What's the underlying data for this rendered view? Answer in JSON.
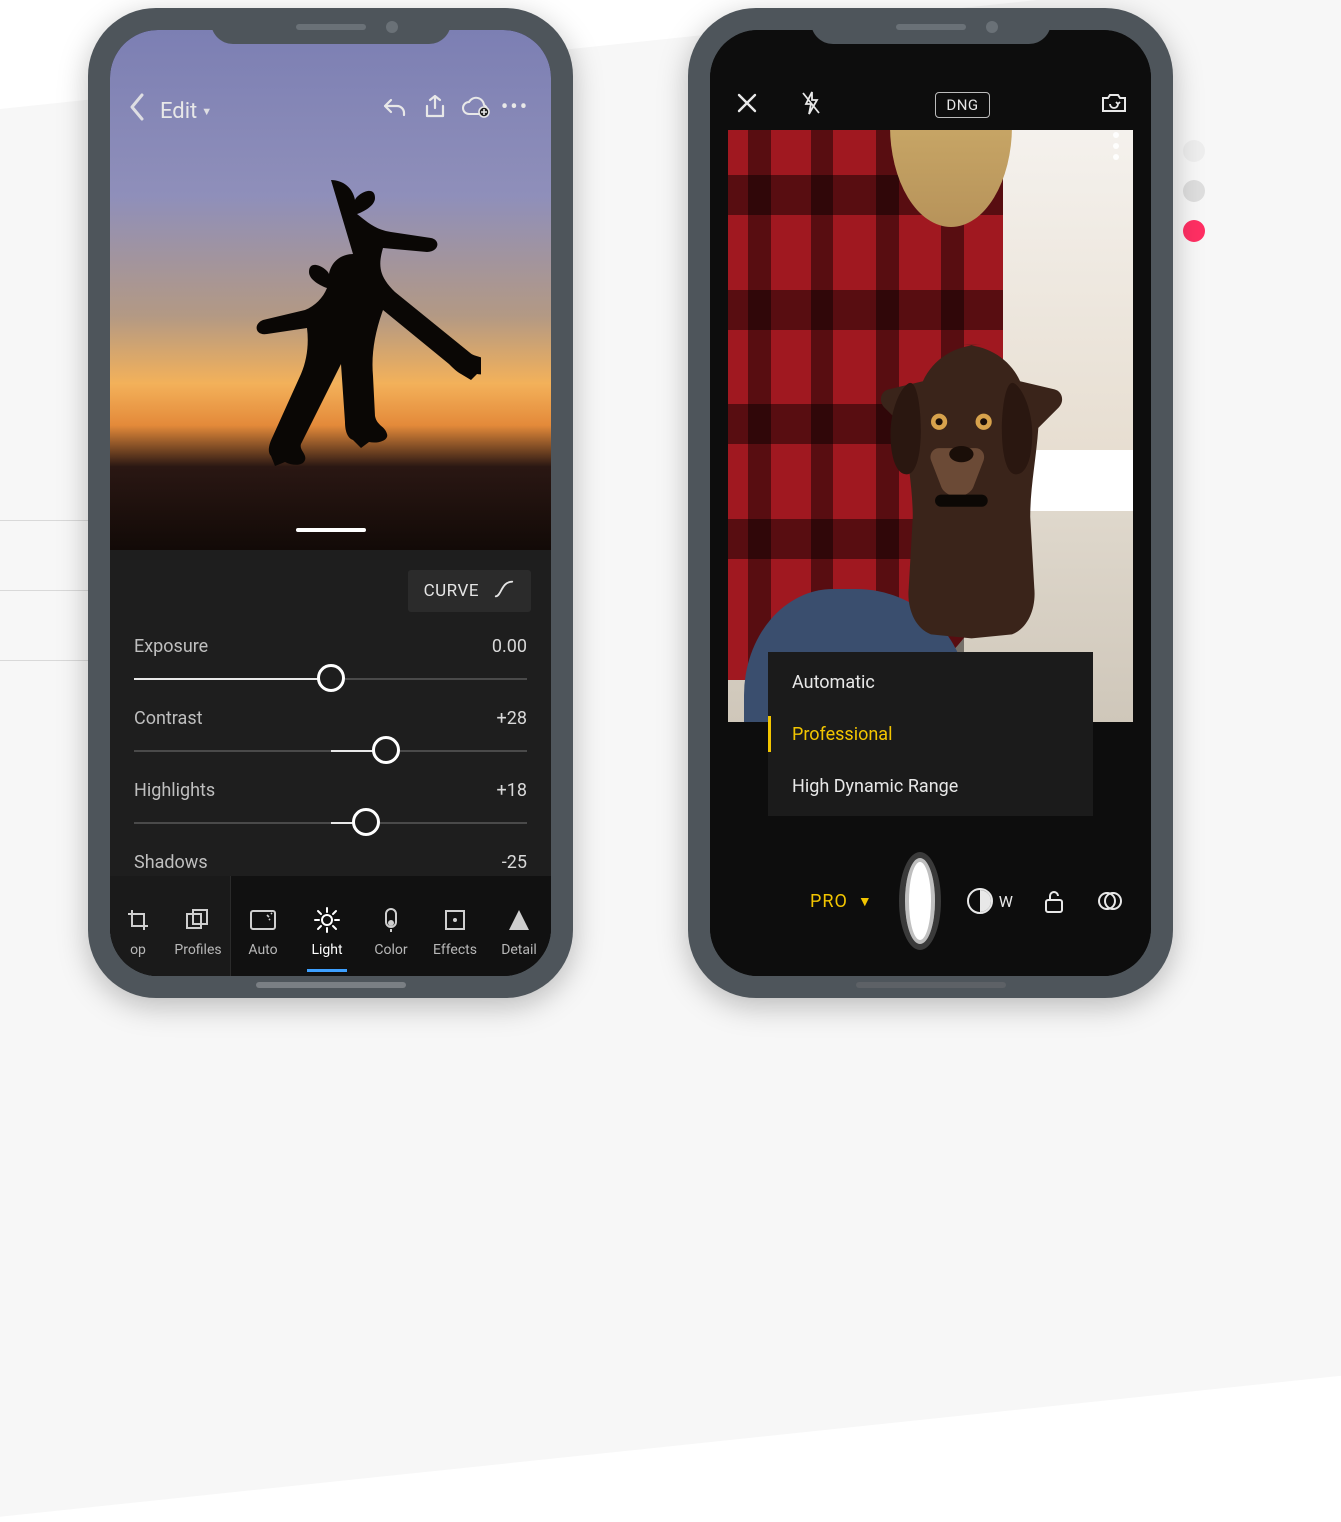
{
  "colors": {
    "accent_blue": "#3ea0ff",
    "accent_yellow": "#f2c500",
    "accent_pink": "#ff2f63",
    "phone_frame": "#4e555b"
  },
  "side_indicator": {
    "dots": [
      "#eeeeee",
      "#dedede",
      "#ff2f63"
    ]
  },
  "left_phone": {
    "header": {
      "back_icon": "chevron-left",
      "title": "Edit",
      "dropdown_icon": "triangle-down",
      "actions": [
        {
          "name": "undo-icon"
        },
        {
          "name": "share-icon"
        },
        {
          "name": "cloud-add-icon"
        },
        {
          "name": "more-icon"
        }
      ]
    },
    "panel": {
      "curve_label": "CURVE",
      "sliders": [
        {
          "key": "exposure",
          "label": "Exposure",
          "value": "0.00",
          "pos": 50
        },
        {
          "key": "contrast",
          "label": "Contrast",
          "value": "+28",
          "pos": 64
        },
        {
          "key": "highlights",
          "label": "Highlights",
          "value": "+18",
          "pos": 59
        },
        {
          "key": "shadows",
          "label": "Shadows",
          "value": "-25",
          "pos": 37
        }
      ]
    },
    "bottom_bar": {
      "items": [
        {
          "key": "crop",
          "label": "op",
          "icon": "crop-icon"
        },
        {
          "key": "profiles",
          "label": "Profiles",
          "icon": "profiles-icon"
        },
        {
          "key": "auto",
          "label": "Auto",
          "icon": "auto-icon"
        },
        {
          "key": "light",
          "label": "Light",
          "icon": "light-icon",
          "active": true
        },
        {
          "key": "color",
          "label": "Color",
          "icon": "color-icon"
        },
        {
          "key": "effects",
          "label": "Effects",
          "icon": "effects-icon"
        },
        {
          "key": "detail",
          "label": "Detail",
          "icon": "detail-icon"
        }
      ]
    }
  },
  "right_phone": {
    "header": {
      "close_icon": "close-icon",
      "flash_icon": "flash-off-icon",
      "format_badge": "DNG",
      "switch_camera_icon": "switch-camera-icon"
    },
    "mode_menu": {
      "items": [
        {
          "label": "Automatic",
          "selected": false
        },
        {
          "label": "Professional",
          "selected": true
        },
        {
          "label": "High Dynamic Range",
          "selected": false
        }
      ]
    },
    "bottom_bar": {
      "mode_label": "PRO",
      "mode_chevron": "chevron-down",
      "shutter": "shutter-button",
      "white_balance_label": "W",
      "right_icons": [
        {
          "name": "white-balance-icon"
        },
        {
          "name": "lock-open-icon"
        },
        {
          "name": "filter-stack-icon"
        }
      ]
    }
  }
}
